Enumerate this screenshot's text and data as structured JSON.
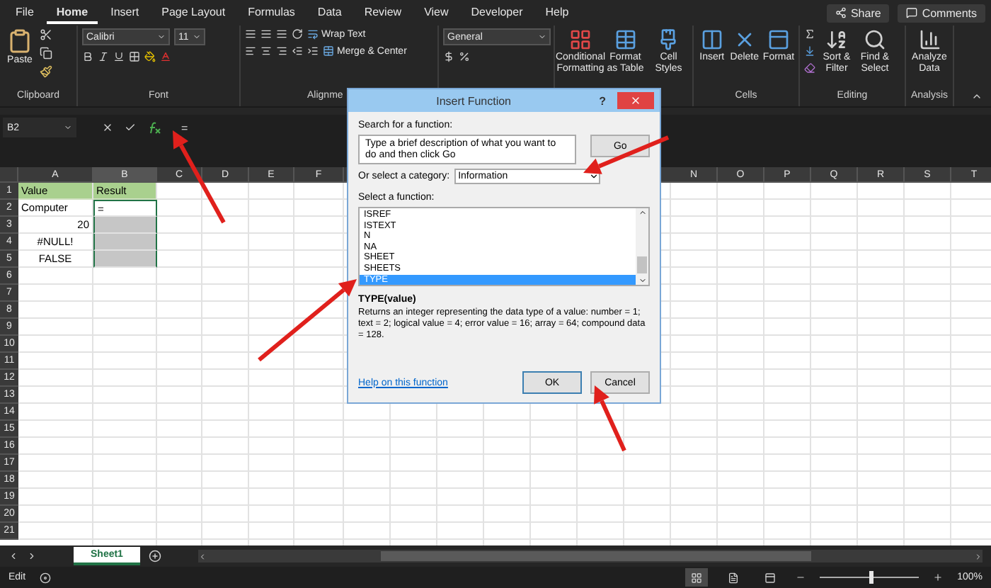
{
  "ribbon": {
    "tabs": [
      {
        "label": "File",
        "selected": false
      },
      {
        "label": "Home",
        "selected": true
      },
      {
        "label": "Insert",
        "selected": false
      },
      {
        "label": "Page Layout",
        "selected": false
      },
      {
        "label": "Formulas",
        "selected": false
      },
      {
        "label": "Data",
        "selected": false
      },
      {
        "label": "Review",
        "selected": false
      },
      {
        "label": "View",
        "selected": false
      },
      {
        "label": "Developer",
        "selected": false
      },
      {
        "label": "Help",
        "selected": false
      }
    ],
    "share": "Share",
    "comments": "Comments",
    "clipboard": {
      "paste": "Paste",
      "label": "Clipboard"
    },
    "font": {
      "name": "Calibri",
      "size": "11",
      "label": "Font"
    },
    "alignment": {
      "wrap_text": "Wrap Text",
      "merge": "Merge & Center",
      "label": "Alignme"
    },
    "number": {
      "format": "General"
    },
    "styles": [
      {
        "kind": "conditional",
        "label": "Conditional Formatting"
      },
      {
        "kind": "table",
        "label": "Format as Table"
      },
      {
        "kind": "cell",
        "label": "Cell Styles"
      }
    ],
    "cells": {
      "buttons": [
        {
          "kind": "insert",
          "label": "Insert"
        },
        {
          "kind": "delete",
          "label": "Delete"
        },
        {
          "kind": "format",
          "label": "Format"
        }
      ],
      "label": "Cells"
    },
    "editing": {
      "buttons": [
        {
          "kind": "sort",
          "label": "Sort & Filter"
        },
        {
          "kind": "find",
          "label": "Find & Select"
        }
      ],
      "label": "Editing"
    },
    "analysis": {
      "button": "Analyze Data",
      "label": "Analysis"
    }
  },
  "formula_bar": {
    "name_box": "B2",
    "formula": "="
  },
  "sheet": {
    "columns": [
      "A",
      "B",
      "C",
      "D",
      "E",
      "F"
    ],
    "columns_right": [
      "N",
      "O",
      "P",
      "Q",
      "R",
      "S",
      "T"
    ],
    "rows": [
      {
        "number": "1",
        "cells": [
          {
            "kind": "header",
            "text": "Value"
          },
          {
            "kind": "header",
            "text": "Result"
          }
        ]
      },
      {
        "number": "2",
        "cells": [
          {
            "kind": "text",
            "text": "Computer"
          },
          {
            "kind": "active",
            "text": "="
          }
        ]
      },
      {
        "number": "3",
        "cells": [
          {
            "kind": "number",
            "text": "20"
          },
          {
            "kind": "selected"
          }
        ]
      },
      {
        "number": "4",
        "cells": [
          {
            "kind": "value",
            "text": "#NULL!"
          },
          {
            "kind": "selected"
          }
        ]
      },
      {
        "number": "5",
        "cells": [
          {
            "kind": "value",
            "text": "FALSE"
          },
          {
            "kind": "selected"
          }
        ]
      },
      {
        "number": "6"
      },
      {
        "number": "7"
      },
      {
        "number": "8"
      },
      {
        "number": "9"
      },
      {
        "number": "10"
      },
      {
        "number": "11"
      },
      {
        "number": "12"
      },
      {
        "number": "13"
      },
      {
        "number": "14"
      },
      {
        "number": "15"
      },
      {
        "number": "16"
      },
      {
        "number": "17"
      },
      {
        "number": "18"
      },
      {
        "number": "19"
      },
      {
        "number": "20"
      },
      {
        "number": "21"
      }
    ]
  },
  "dialog": {
    "title": "Insert Function",
    "help": "?",
    "search_label": "Search for a function:",
    "search_value": "Type a brief description of what you want to do and then click Go",
    "go": "Go",
    "category_label": "Or select a category:",
    "category": "Information",
    "select_label": "Select a function:",
    "functions": [
      {
        "name": "ISREF",
        "selected": false
      },
      {
        "name": "ISTEXT",
        "selected": false
      },
      {
        "name": "N",
        "selected": false
      },
      {
        "name": "NA",
        "selected": false
      },
      {
        "name": "SHEET",
        "selected": false
      },
      {
        "name": "SHEETS",
        "selected": false
      },
      {
        "name": "TYPE",
        "selected": true
      }
    ],
    "signature": "TYPE(value)",
    "description": "Returns an integer representing the data type of a value: number = 1; text = 2; logical value = 4; error value = 16; array = 64; compound data = 128.",
    "help_link": "Help on this function",
    "ok": "OK",
    "cancel": "Cancel"
  },
  "sheet_tabs": [
    {
      "label": "Sheet1",
      "selected": true
    }
  ],
  "status": {
    "mode": "Edit",
    "views": [
      {
        "kind": "normal",
        "selected": true
      },
      {
        "kind": "page_layout",
        "selected": false
      },
      {
        "kind": "page_break",
        "selected": false
      }
    ],
    "zoom": {
      "level": 0.5,
      "reading": "100%"
    }
  }
}
